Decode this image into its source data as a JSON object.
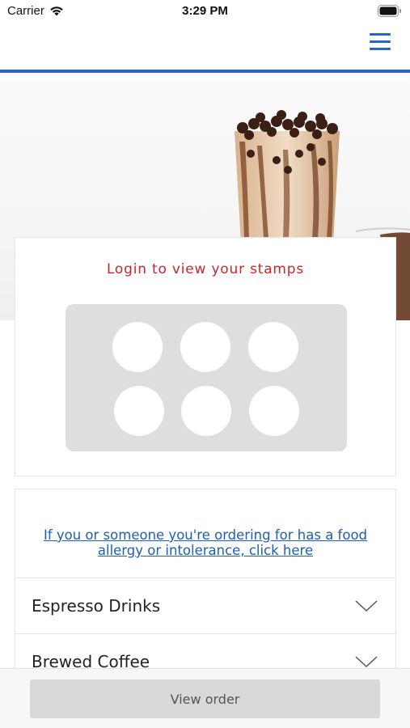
{
  "status_bar": {
    "carrier": "Carrier",
    "time": "3:29 PM"
  },
  "nav": {
    "menu_icon": "hamburger-menu-icon",
    "accent_color": "#2a62c6"
  },
  "stamp_card": {
    "title": "Login to view your stamps",
    "stamp_count": 6,
    "title_color": "#c5282b"
  },
  "allergy_notice": {
    "link_text": "If you or someone you're ordering for has a food allergy or intolerance, click here"
  },
  "categories": [
    {
      "label": "Espresso Drinks",
      "icon": "chevron-down-icon"
    },
    {
      "label": "Brewed Coffee",
      "icon": "chevron-down-icon"
    }
  ],
  "bottom_bar": {
    "view_order_label": "View order"
  }
}
